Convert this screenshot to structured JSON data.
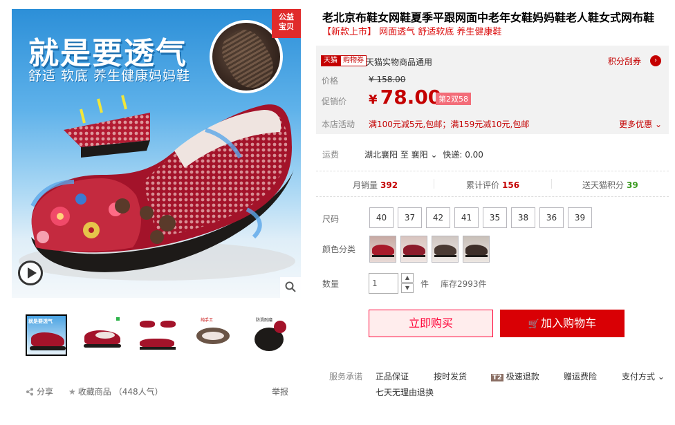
{
  "gallery": {
    "banner_title": "就是要透气",
    "banner_subtitle": "舒适 软底 养生健康妈妈鞋",
    "charity_badge_line1": "公益",
    "charity_badge_line2": "宝贝",
    "play_icon": "play-circle-icon",
    "zoom_icon": "magnifier-icon",
    "thumbnails": [
      "thumb-1",
      "thumb-2",
      "thumb-3",
      "thumb-4",
      "thumb-5"
    ],
    "thumb1_label": "就是要透气",
    "thumb4_label": "纯手工",
    "thumb5_label": "防滑耐磨"
  },
  "actions": {
    "share": "分享",
    "favorite": "收藏商品",
    "favorite_count": "（448人气）",
    "report": "举报"
  },
  "product": {
    "title": "老北京布鞋女网鞋夏季平跟网面中老年女鞋妈妈鞋老人鞋女式网布鞋",
    "subtitle": "【新款上市】 网面透气 舒适软底 养生健康鞋"
  },
  "price": {
    "tmall_badge_1": "天猫",
    "tmall_badge_2": "购物券",
    "tmall_text": "天猫实物商品通用",
    "points_link": "积分刮券",
    "price_label": "价格",
    "original_price": "¥ 158.00",
    "promo_label": "促销价",
    "currency": "¥",
    "promo_price": "78.00",
    "promo_tag": "第2双58",
    "activity_label": "本店活动",
    "activity_text": "满100元减5元,包邮；满159元减10元,包邮",
    "more_promo": "更多优惠"
  },
  "shipping": {
    "label": "运费",
    "text": "湖北襄阳  至 襄阳",
    "express": "快递: 0.00"
  },
  "stats": {
    "monthly_sales_label": "月销量",
    "monthly_sales": "392",
    "reviews_label": "累计评价",
    "reviews": "156",
    "points_label": "送天猫积分",
    "points": "39"
  },
  "options": {
    "size_label": "尺码",
    "sizes": [
      "40",
      "37",
      "42",
      "41",
      "35",
      "38",
      "36",
      "39"
    ],
    "color_label": "颜色分类",
    "colors": [
      "#a81a2a",
      "#8c1b2b",
      "#4a3a33",
      "#3d2e29"
    ],
    "qty_label": "数量",
    "qty_value": "1",
    "qty_unit": "件",
    "stock": "库存2993件"
  },
  "buttons": {
    "buy_now": "立即购买",
    "add_to_cart": "加入购物车"
  },
  "service": {
    "label": "服务承诺",
    "items": [
      "正品保证",
      "按时发货",
      "极速退款",
      "赠运费险",
      "支付方式",
      "七天无理由退换"
    ],
    "t2_badge": "T2"
  }
}
